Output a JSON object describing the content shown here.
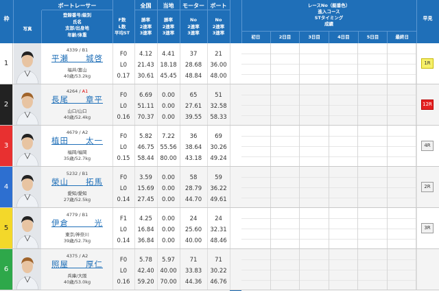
{
  "header": {
    "waku": "枠",
    "photo": "写真",
    "boat_racer": "ボートレーサー",
    "racer_info_lines": [
      "登録番号/級別",
      "氏名",
      "支部/出身地",
      "年齢/体重"
    ],
    "stat_lines": [
      "F数",
      "L数",
      "平均ST"
    ],
    "national": "全国",
    "local": "当地",
    "motor": "モーター",
    "boat": "ボート",
    "national_lines": [
      "勝率",
      "2連率",
      "3連率"
    ],
    "local_lines": [
      "勝率",
      "2連率",
      "3連率"
    ],
    "motor_lines": [
      "No",
      "2連率",
      "3連率"
    ],
    "boat_lines": [
      "No",
      "2連率",
      "3連率"
    ],
    "race_info_lines": [
      "レースNo（艇番色）",
      "進入コース",
      "STタイミング",
      "成績"
    ],
    "days": [
      "初日",
      "2日目",
      "3日目",
      "4日目",
      "5日目",
      "最終日"
    ],
    "hayami": "早見"
  },
  "konsetsu_chars": [
    "今",
    "節",
    "成",
    "績"
  ],
  "colors": {
    "header_blue": "#1f6fb8",
    "frame_1": "#ffffff",
    "frame_2": "#222222",
    "frame_3": "#e83030",
    "frame_4": "#2d6fd0",
    "frame_5": "#f3d82a",
    "frame_6": "#2ea84a"
  },
  "racers": [
    {
      "waku": "1",
      "reg": "4339 / B1",
      "reg_class": "",
      "name": "平瀬　　城啓",
      "place": "福井/富山",
      "age": "40歳/53.2kg",
      "stat": [
        "F0",
        "L0",
        "0.17"
      ],
      "national": [
        "4.12",
        "21.43",
        "30.61"
      ],
      "local": [
        "4.41",
        "18.18",
        "45.45"
      ],
      "motor": [
        "37",
        "28.68",
        "48.84"
      ],
      "boat": [
        "21",
        "36.00",
        "48.00"
      ],
      "hayami": "1R",
      "hayami_style": "yellow"
    },
    {
      "waku": "2",
      "reg": "4264 / ",
      "reg_class": "A1",
      "name": "長尾　　章平",
      "place": "山口/山口",
      "age": "40歳/52.4kg",
      "stat": [
        "F0",
        "L0",
        "0.16"
      ],
      "national": [
        "6.69",
        "51.11",
        "70.37"
      ],
      "local": [
        "0.00",
        "0.00",
        "0.00"
      ],
      "motor": [
        "65",
        "27.61",
        "39.55"
      ],
      "boat": [
        "51",
        "32.58",
        "58.33"
      ],
      "hayami": "12R",
      "hayami_style": "red"
    },
    {
      "waku": "3",
      "reg": "4679 / A2",
      "reg_class": "",
      "name": "植田　　太一",
      "place": "福岡/福岡",
      "age": "35歳/52.7kg",
      "stat": [
        "F0",
        "L0",
        "0.15"
      ],
      "national": [
        "5.82",
        "46.75",
        "58.44"
      ],
      "local": [
        "7.22",
        "55.56",
        "80.00"
      ],
      "motor": [
        "36",
        "38.64",
        "43.18"
      ],
      "boat": [
        "69",
        "30.26",
        "49.24"
      ],
      "hayami": "4R",
      "hayami_style": "gray"
    },
    {
      "waku": "4",
      "reg": "5232 / B1",
      "reg_class": "",
      "name": "榮山　　拓馬",
      "place": "愛知/愛知",
      "age": "27歳/52.5kg",
      "stat": [
        "F0",
        "L0",
        "0.14"
      ],
      "national": [
        "3.59",
        "15.69",
        "27.45"
      ],
      "local": [
        "0.00",
        "0.00",
        "0.00"
      ],
      "motor": [
        "58",
        "28.79",
        "44.70"
      ],
      "boat": [
        "59",
        "36.22",
        "49.61"
      ],
      "hayami": "2R",
      "hayami_style": "gray"
    },
    {
      "waku": "5",
      "reg": "4779 / B1",
      "reg_class": "",
      "name": "伊倉　　　光",
      "place": "東京/神奈川",
      "age": "39歳/52.7kg",
      "stat": [
        "F1",
        "L0",
        "0.14"
      ],
      "national": [
        "4.25",
        "16.84",
        "36.84"
      ],
      "local": [
        "0.00",
        "0.00",
        "0.00"
      ],
      "motor": [
        "24",
        "25.60",
        "40.00"
      ],
      "boat": [
        "32.31",
        "48.46",
        ""
      ],
      "boat_no": "24",
      "hayami": "3R",
      "hayami_style": "gray"
    },
    {
      "waku": "6",
      "reg": "4375 / A2",
      "reg_class": "",
      "name": "照屋　　厚仁",
      "place": "兵庫/大阪",
      "age": "40歳/53.0kg",
      "stat": [
        "F0",
        "L0",
        "0.16"
      ],
      "national": [
        "5.78",
        "42.40",
        "59.20"
      ],
      "local": [
        "5.97",
        "40.00",
        "70.00"
      ],
      "motor": [
        "71",
        "33.83",
        "44.36"
      ],
      "boat": [
        "30.22",
        "30.76",
        "46.76"
      ],
      "hayami": "",
      "hayami_style": "gray"
    }
  ]
}
